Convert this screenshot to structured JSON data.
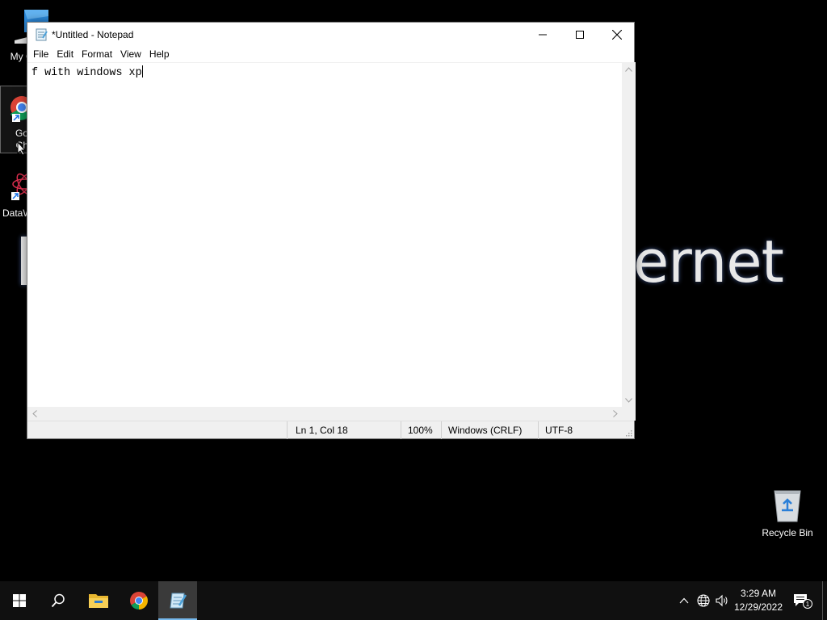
{
  "wallpaper": {
    "visible_text": "ernet"
  },
  "desktop_icons": [
    {
      "name": "my-computer",
      "label": "My Co"
    },
    {
      "name": "google-chrome",
      "label": "Go\nCh"
    },
    {
      "name": "dataw",
      "label": "DataW"
    },
    {
      "name": "recycle-bin",
      "label": "Recycle Bin"
    }
  ],
  "notepad": {
    "title": "*Untitled - Notepad",
    "menu": [
      "File",
      "Edit",
      "Format",
      "View",
      "Help"
    ],
    "content": "f with windows xp",
    "status": {
      "position": "Ln 1, Col 18",
      "zoom": "100%",
      "line_endings": "Windows (CRLF)",
      "encoding": "UTF-8"
    }
  },
  "taskbar": {
    "pinned": [
      "start-icon",
      "search-icon",
      "file-explorer-icon",
      "chrome-icon",
      "notepad-icon"
    ],
    "active": "notepad",
    "clock": {
      "time": "3:29 AM",
      "date": "12/29/2022"
    },
    "notification_count": "1"
  },
  "colors": {
    "taskbar_bg": "#101010",
    "active_indicator": "#76b9ed",
    "window_bg": "#ffffff",
    "statusbar_bg": "#f0f0f0"
  }
}
